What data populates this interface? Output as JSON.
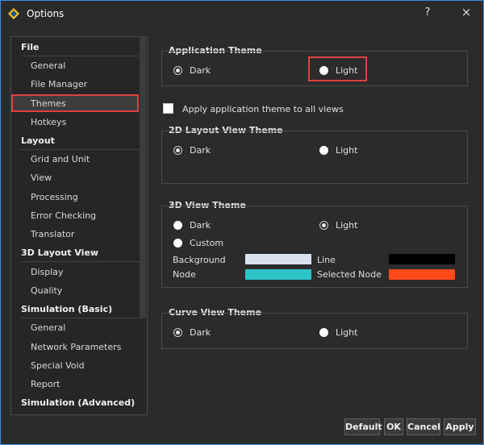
{
  "window": {
    "title": "Options",
    "help_label": "?",
    "close_label": "×"
  },
  "nav": {
    "groups": [
      {
        "label": "File",
        "items": [
          "General",
          "File Manager",
          "Themes",
          "Hotkeys"
        ]
      },
      {
        "label": "Layout",
        "items": [
          "Grid and Unit",
          "View",
          "Processing",
          "Error Checking",
          "Translator"
        ]
      },
      {
        "label": "3D Layout View",
        "items": [
          "Display",
          "Quality"
        ]
      },
      {
        "label": "Simulation (Basic)",
        "items": [
          "General",
          "Network Parameters",
          "Special Void",
          "Report"
        ]
      },
      {
        "label": "Simulation (Advanced)",
        "items": []
      }
    ],
    "selected": "Themes"
  },
  "app_theme": {
    "title": "Application Theme",
    "dark": "Dark",
    "light": "Light",
    "selected": "Light"
  },
  "apply_all": {
    "label": "Apply application theme to all views",
    "checked": false
  },
  "layout_theme": {
    "title": "2D Layout View Theme",
    "dark": "Dark",
    "light": "Light",
    "selected": "Dark"
  },
  "view3d_theme": {
    "title": "3D View Theme",
    "dark": "Dark",
    "light": "Light",
    "custom": "Custom",
    "selected": "Light",
    "background_label": "Background",
    "line_label": "Line",
    "node_label": "Node",
    "selected_node_label": "Selected Node",
    "colors": {
      "background": "#d9e3f0",
      "line": "#000000",
      "node": "#2ec4c9",
      "selected_node": "#ff4a1a"
    }
  },
  "curve_theme": {
    "title": "Curve View Theme",
    "dark": "Dark",
    "light": "Light",
    "selected": "Dark"
  },
  "buttons": {
    "default": "Default",
    "ok": "OK",
    "cancel": "Cancel",
    "apply": "Apply"
  },
  "accent": "#3a8ee6",
  "highlight": "#e04040"
}
